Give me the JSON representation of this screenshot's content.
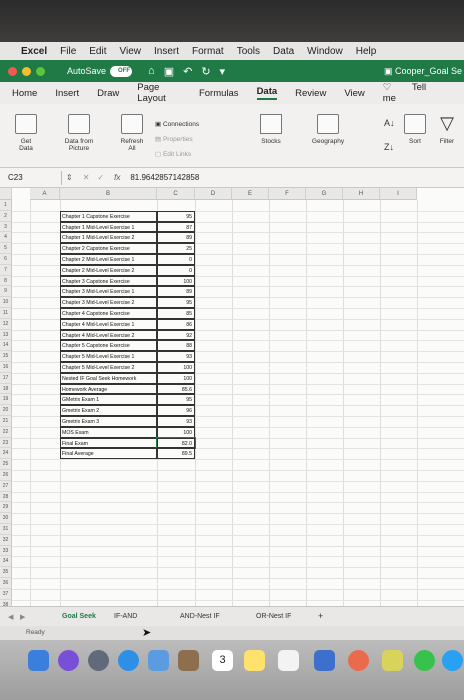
{
  "menubar": {
    "app": "Excel",
    "items": [
      "File",
      "Edit",
      "View",
      "Insert",
      "Format",
      "Tools",
      "Data",
      "Window",
      "Help"
    ]
  },
  "titlebar": {
    "autosave_label": "AutoSave",
    "autosave_state": "OFF",
    "doc_title": "Cooper_Goal Se"
  },
  "ribbon_tabs": [
    "Home",
    "Insert",
    "Draw",
    "Page Layout",
    "Formulas",
    "Data",
    "Review",
    "View"
  ],
  "active_tab": "Data",
  "tell_me": "Tell me",
  "ribbon": {
    "get_data": "Get\nData",
    "data_from_picture": "Data from\nPicture",
    "refresh_all": "Refresh\nAll",
    "connections": "Connections",
    "properties": "Properties",
    "edit_links": "Edit Links",
    "stocks": "Stocks",
    "geography": "Geography",
    "sort": "Sort",
    "filter": "Filter"
  },
  "formula_bar": {
    "name_box": "C23",
    "fx": "fx",
    "value": "81.9642857142858"
  },
  "columns": [
    "A",
    "B",
    "C",
    "D",
    "E",
    "F",
    "G",
    "H",
    "I"
  ],
  "rows": [
    {
      "label": "Chapter 1 Capstone Exercise",
      "value": "95"
    },
    {
      "label": "Chapter 1 Mid-Level Exercise 1",
      "value": "87"
    },
    {
      "label": "Chapter 1 Mid-Level Exercise 2",
      "value": "89"
    },
    {
      "label": "Chapter 2 Capstone Exercise",
      "value": "25"
    },
    {
      "label": "Chapter 2 Mid-Level Exercise 1",
      "value": "0"
    },
    {
      "label": "Chapter 2 Mid-Level Exercise 2",
      "value": "0"
    },
    {
      "label": "Chapter 3 Capstone Exercise",
      "value": "100"
    },
    {
      "label": "Chapter 3 Mid-Level Exercise 1",
      "value": "89"
    },
    {
      "label": "Chapter 3 Mid-Level Exercise 2",
      "value": "95"
    },
    {
      "label": "Chapter 4 Capstone Exercise",
      "value": "85"
    },
    {
      "label": "Chapter 4 Mid-Level Exercise 1",
      "value": "86"
    },
    {
      "label": "Chapter 4 Mid-Level Exercise 2",
      "value": "92"
    },
    {
      "label": "Chapter 5 Capstone Exercise",
      "value": "88"
    },
    {
      "label": "Chapter 5 Mid-Level Exercise 1",
      "value": "93"
    },
    {
      "label": "Chapter 5 Mid-Level Exercise 2",
      "value": "100"
    },
    {
      "label": "Nested IF Goal Seek Homework",
      "value": "100"
    },
    {
      "label": "Homework Average",
      "value": "85.6"
    },
    {
      "label": "GMetrix Exam 1",
      "value": "95"
    },
    {
      "label": "Gmetrix Exam 2",
      "value": "96"
    },
    {
      "label": "Gmetrix Exam 3",
      "value": "93"
    },
    {
      "label": "MOS Exam",
      "value": "100"
    },
    {
      "label": "Final Exam",
      "value": "82.0"
    },
    {
      "label": "Final Average",
      "value": "89.5"
    }
  ],
  "sheet_tabs": [
    "Goal Seek",
    "IF-AND",
    "AND-Nest IF",
    "OR-Nest IF"
  ],
  "active_sheet": "Goal Seek",
  "add_sheet": "+",
  "status": "Ready",
  "dock_calendar_day": "3",
  "colors": {
    "excel_green": "#1f7a46"
  }
}
